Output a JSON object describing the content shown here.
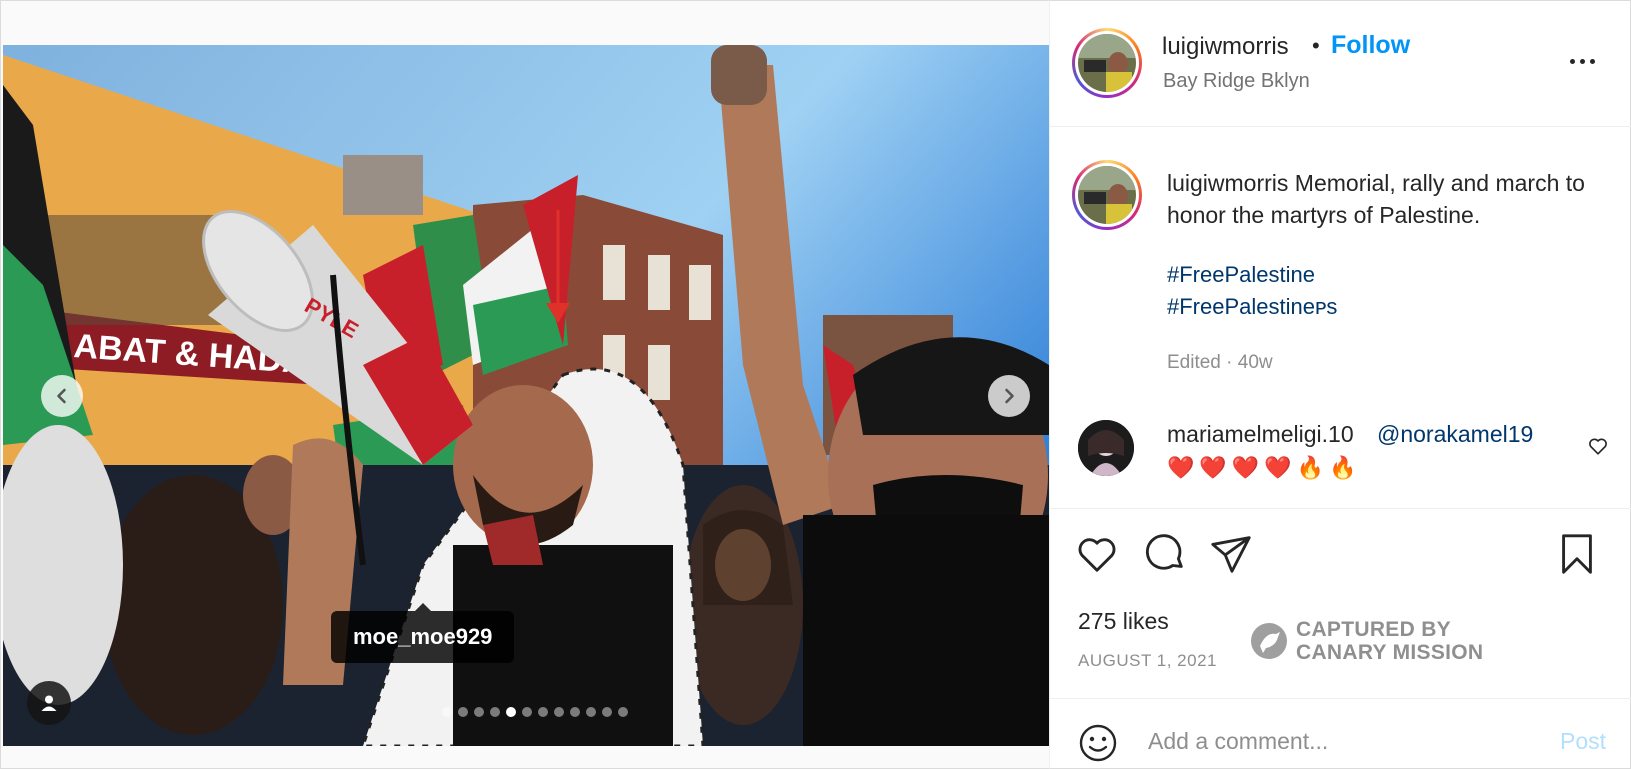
{
  "post": {
    "username": "luigiwmorris",
    "bullet": "•",
    "follow_label": "Follow",
    "location": "Bay Ridge Bklyn",
    "more_icon": "more-horizontal-icon"
  },
  "media": {
    "photo_tag_username": "moe_moe929",
    "slide_count": 12,
    "active_slide": 5,
    "prev_icon": "chevron-left-icon",
    "next_icon": "chevron-right-icon",
    "user_tag_icon": "user-tag-icon",
    "megaphone_brand": "PYLE",
    "storefront_text": "ABAT & HADA"
  },
  "caption": {
    "username": "luigiwmorris",
    "text": "Memorial, rally and march to honor the martyrs of Palestine.",
    "hashtags": [
      "#FreePalestine",
      "#FreePalestineᴘs"
    ],
    "edited": "Edited · 40w"
  },
  "comment": {
    "username": "mariamelmeligi.10",
    "mention": "@norakamel19",
    "emojis": [
      "❤️",
      "❤️",
      "❤️",
      "❤️",
      "🔥",
      "🔥"
    ],
    "like_icon": "heart-outline-icon"
  },
  "actions": {
    "like_icon": "heart-icon",
    "comment_icon": "comment-icon",
    "share_icon": "share-icon",
    "save_icon": "bookmark-icon"
  },
  "stats": {
    "likes": "275 likes",
    "date": "AUGUST 1, 2021"
  },
  "watermark": {
    "line1": "CAPTURED BY",
    "line2": "CANARY MISSION"
  },
  "comment_bar": {
    "placeholder": "Add a comment...",
    "post_label": "Post",
    "emoji_icon": "smiley-icon"
  },
  "colors": {
    "link_blue": "#0095f6",
    "hashtag_blue": "#00376b",
    "muted": "#8e8e8e"
  }
}
